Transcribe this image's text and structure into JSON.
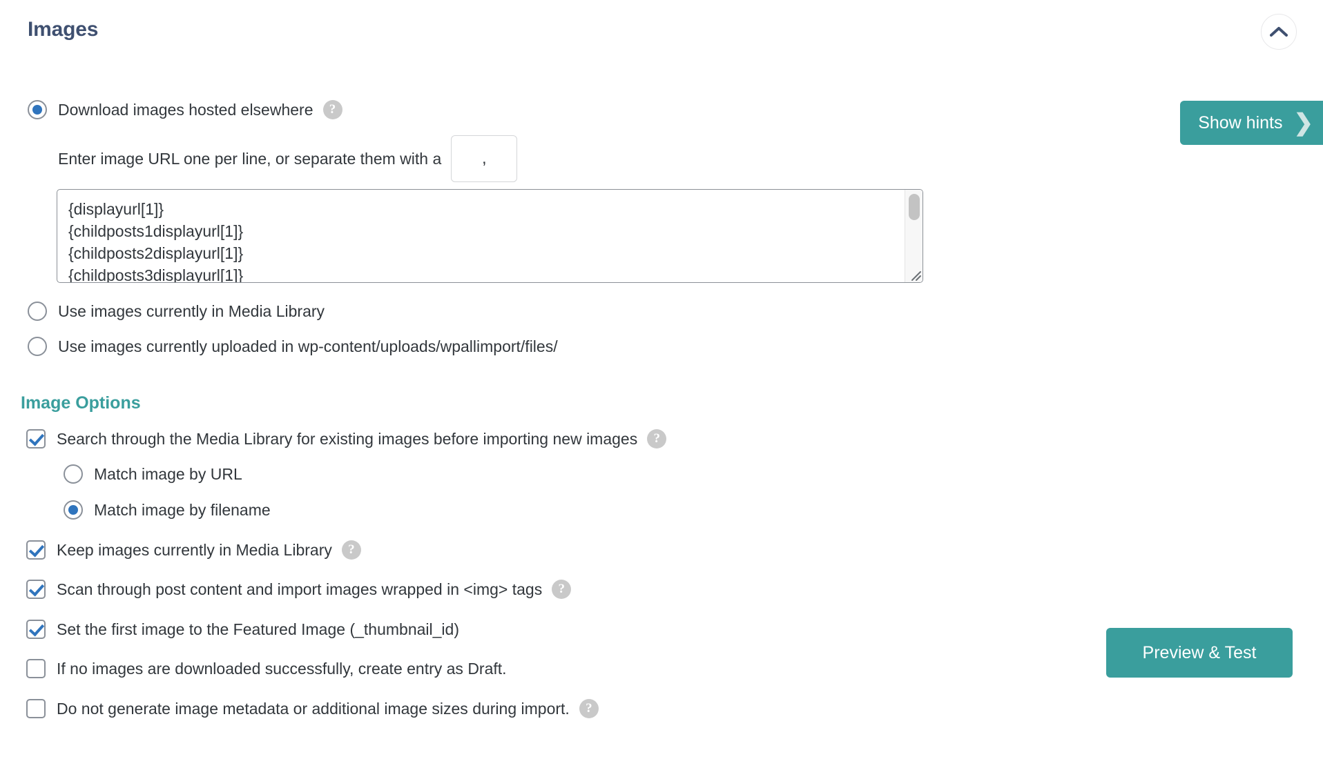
{
  "panel": {
    "title": "Images",
    "collapse_icon": "chevron-up-icon"
  },
  "show_hints": {
    "label": "Show hints",
    "arrow_icon": "chevron-right-icon"
  },
  "source_options": [
    {
      "id": "download-elsewhere",
      "label": "Download images hosted elsewhere",
      "checked": true,
      "has_help": true
    },
    {
      "id": "media-library",
      "label": "Use images currently in Media Library",
      "checked": false,
      "has_help": false
    },
    {
      "id": "uploads-folder",
      "label": "Use images currently uploaded in wp-content/uploads/wpallimport/files/",
      "checked": false,
      "has_help": false
    }
  ],
  "separator": {
    "label": "Enter image URL one per line, or separate them with a",
    "value": ",",
    "placeholder": ""
  },
  "urls_textarea": {
    "value": "{displayurl[1]}\n{childposts1displayurl[1]}\n{childposts2displayurl[1]}\n{childposts3displayurl[1]}",
    "placeholder": ""
  },
  "image_options": {
    "title": "Image Options",
    "items": [
      {
        "id": "search-media-library",
        "label": "Search through the Media Library for existing images before importing new images",
        "checked": true,
        "has_help": true
      },
      {
        "id": "keep-images",
        "label": "Keep images currently in Media Library",
        "checked": true,
        "has_help": true
      },
      {
        "id": "scan-post-content",
        "label": "Scan through post content and import images wrapped in <img> tags",
        "checked": true,
        "has_help": true
      },
      {
        "id": "set-featured-image",
        "label": "Set the first image to the Featured Image (_thumbnail_id)",
        "checked": true,
        "has_help": false
      },
      {
        "id": "create-draft",
        "label": "If no images are downloaded successfully, create entry as Draft.",
        "checked": false,
        "has_help": false
      },
      {
        "id": "no-metadata",
        "label": "Do not generate image metadata or additional image sizes during import.",
        "checked": false,
        "has_help": true
      }
    ],
    "match_options": [
      {
        "id": "match-by-url",
        "label": "Match image by URL",
        "checked": false
      },
      {
        "id": "match-by-filename",
        "label": "Match image by filename",
        "checked": true
      }
    ]
  },
  "preview_button": {
    "label": "Preview & Test"
  },
  "colors": {
    "title_blue": "#3f5070",
    "teal": "#3a9e9d",
    "radio_blue": "#2f74bd",
    "help_gray": "#c9c9c9"
  }
}
